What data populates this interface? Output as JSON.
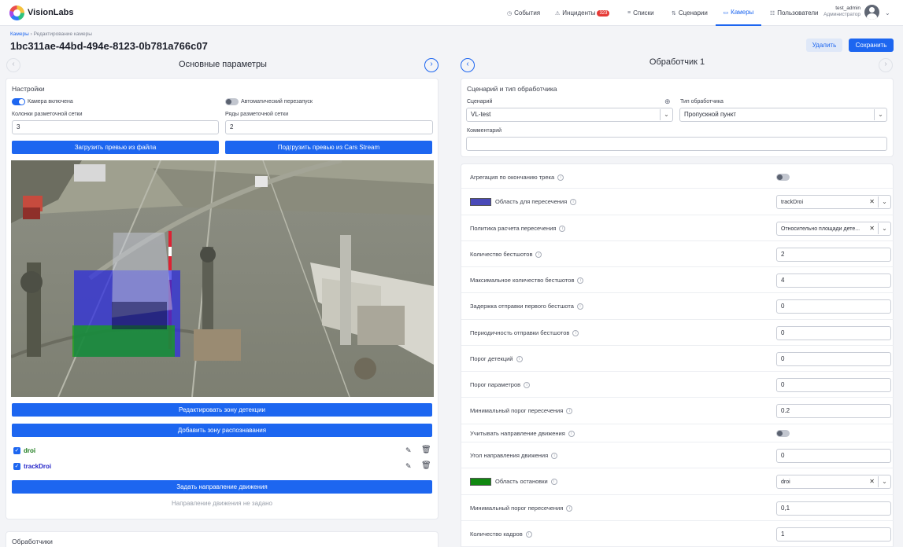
{
  "app": {
    "brand": "VisionLabs"
  },
  "nav": {
    "events": "События",
    "incidents": "Инциденты",
    "incidents_count": "323",
    "lists": "Списки",
    "scenarios": "Сценарии",
    "cameras": "Камеры",
    "users": "Пользователи"
  },
  "user": {
    "name": "test_admin",
    "role": "Администратор"
  },
  "breadcrumb": {
    "root": "Камеры",
    "sep": "›",
    "current": "Редактирование камеры"
  },
  "page": {
    "title": "1bc311ae-44bd-494e-8123-0b781a766c07",
    "delete": "Удалить",
    "save": "Сохранить"
  },
  "left": {
    "section_title": "Основные параметры",
    "settings": "Настройки",
    "camera_on": "Камера включена",
    "auto_restart": "Автоматический перезапуск",
    "grid_cols_label": "Колонки разметочной сетки",
    "grid_cols": "3",
    "grid_rows_label": "Ряды разметочной сетки",
    "grid_rows": "2",
    "load_preview_file": "Загрузить превью из файла",
    "load_preview_stream": "Подгрузить превью из Cars Stream",
    "edit_zone": "Редактировать зону детекции",
    "add_zone": "Добавить зону распознавания",
    "zones": [
      {
        "name": "droi",
        "color": "#1a7a1a"
      },
      {
        "name": "trackDroi",
        "color": "#2525c8"
      }
    ],
    "set_direction": "Задать направление движения",
    "direction_none": "Направление движения не задано",
    "handlers": "Обработчики"
  },
  "right": {
    "section_title": "Обработчик 1",
    "scenario_card": "Сценарий и тип обработчика",
    "scenario_label": "Сценарий",
    "scenario_value": "VL-test",
    "type_label": "Тип обработчика",
    "type_value": "Пропускной пункт",
    "comment_label": "Комментарий",
    "comment_value": "",
    "params": [
      {
        "label": "Агрегация по окончанию трека",
        "kind": "toggle",
        "on": false
      },
      {
        "label": "Область для пересечения",
        "kind": "select",
        "value": "trackDroi",
        "swatch": "#4a4ab8",
        "clearable": true
      },
      {
        "label": "Политика расчета пересечения",
        "kind": "select",
        "value": "Относительно площади дете...",
        "clearable": true
      },
      {
        "label": "Количество бестшотов",
        "kind": "input",
        "value": "2"
      },
      {
        "label": "Максимальное количество бестшотов",
        "kind": "input",
        "value": "4"
      },
      {
        "label": "Задержка отправки первого бестшота",
        "kind": "input",
        "value": "0"
      },
      {
        "label": "Периодичность отправки бестшотов",
        "kind": "input",
        "value": "0"
      },
      {
        "label": "Порог детекций",
        "kind": "input",
        "value": "0"
      },
      {
        "label": "Порог параметров",
        "kind": "input",
        "value": "0"
      },
      {
        "label": "Минимальный порог пересечения",
        "kind": "input",
        "value": "0.2"
      },
      {
        "label": "Учитывать направление движения",
        "kind": "toggle",
        "on": false
      },
      {
        "label": "Угол направления движения",
        "kind": "input",
        "value": "0"
      },
      {
        "label": "Область остановки",
        "kind": "select",
        "value": "droi",
        "swatch": "#118811",
        "clearable": true
      },
      {
        "label": "Минимальный порог пересечения",
        "kind": "input",
        "value": "0,1"
      },
      {
        "label": "Количество кадров",
        "kind": "input",
        "value": "1"
      }
    ]
  }
}
